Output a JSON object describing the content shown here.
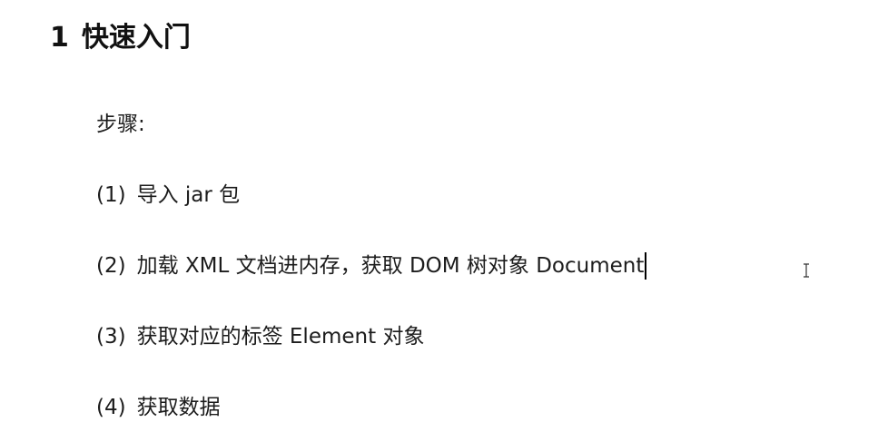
{
  "heading": {
    "number": "1",
    "title": "快速入门"
  },
  "steps_label": "步骤:",
  "steps": [
    {
      "num": "(1)",
      "text": "导入 jar 包"
    },
    {
      "num": "(2)",
      "text": "加载 XML 文档进内存，获取 DOM 树对象 Document"
    },
    {
      "num": "(3)",
      "text": "获取对应的标签 Element 对象"
    },
    {
      "num": "(4)",
      "text": "获取数据"
    }
  ],
  "cursor_icon": "text-ibeam-cursor-icon"
}
